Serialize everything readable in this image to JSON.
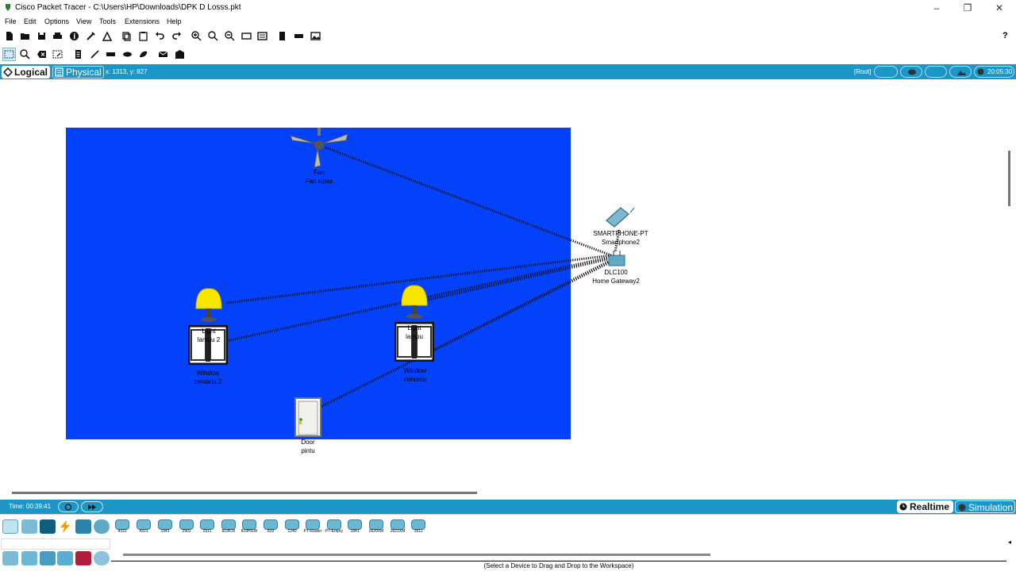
{
  "window": {
    "title": "Cisco Packet Tracer - C:\\Users\\HP\\Downloads\\DPK D Losss.pkt",
    "minimize": "–",
    "maximize": "❐",
    "close": "✕"
  },
  "menu": [
    "File",
    "Edit",
    "Options",
    "View",
    "Tools",
    "Extensions",
    "Help"
  ],
  "toolbar": {
    "help": "?"
  },
  "modebar": {
    "logical": "Logical",
    "physical": "Physical",
    "coords": "x: 1313, y: 827",
    "root": "[Root]",
    "time": "20:05:30"
  },
  "devices": {
    "fan": {
      "name": "Fan",
      "label": "Fan kipas"
    },
    "smartphone": {
      "name": "SMARTPHONE-PT",
      "label": "Smartphone2"
    },
    "gateway": {
      "name": "DLC100",
      "label": "Home Gateway2"
    },
    "light2": {
      "name": "Light",
      "label": "lampu 2"
    },
    "light1": {
      "name": "Light",
      "label": "lampu"
    },
    "window2": {
      "name": "Window",
      "label": "cendela 2"
    },
    "window1": {
      "name": "Window",
      "label": "cendela"
    },
    "door": {
      "name": "Door",
      "label": "pintu"
    }
  },
  "status": {
    "time": "Time: 00:39:41",
    "realtime": "Realtime",
    "simulation": "Simulation"
  },
  "device_list": [
    "4331",
    "4321",
    "1941",
    "2901",
    "2911",
    "819IOX",
    "819HGW",
    "829",
    "1240",
    "PT-Router",
    "PT-Empty",
    "1841",
    "2620XM",
    "2621XM",
    "2811"
  ],
  "hint": "(Select a Device to Drag and Drop to the Workspace)",
  "colors": {
    "accent": "#1b96c6",
    "room": "#0341fb",
    "lamp": "#f7e600"
  }
}
